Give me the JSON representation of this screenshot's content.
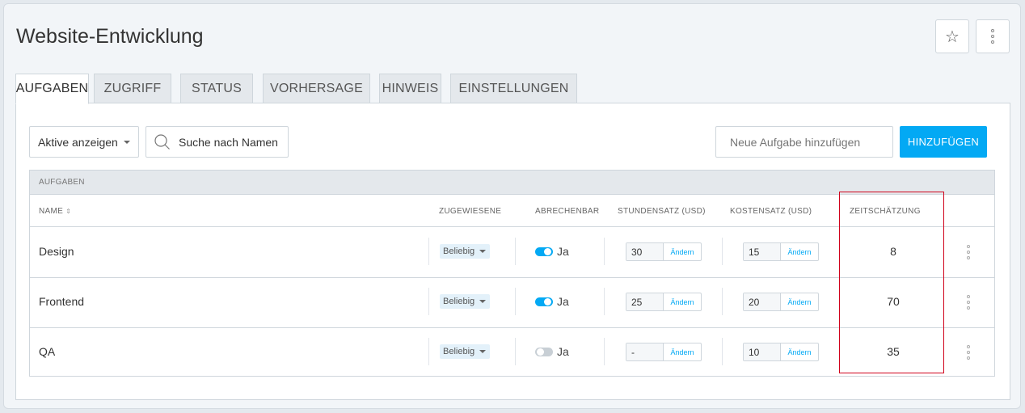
{
  "header": {
    "title": "Website-Entwicklung",
    "star_icon": "☆",
    "more_icon": "more-vertical-icon"
  },
  "tabs": [
    {
      "label": "AUFGABEN",
      "active": true
    },
    {
      "label": "ZUGRIFF",
      "active": false
    },
    {
      "label": "STATUS",
      "active": false
    },
    {
      "label": "VORHERSAGE",
      "active": false
    },
    {
      "label": "HINWEIS",
      "active": false
    },
    {
      "label": "EINSTELLUNGEN",
      "active": false
    }
  ],
  "toolbar": {
    "filter_label": "Aktive anzeigen",
    "search_label": "Suche nach Namen",
    "new_task_placeholder": "Neue Aufgabe hinzufügen",
    "add_button": "HINZUFÜGEN"
  },
  "table": {
    "group_header": "AUFGABEN",
    "columns": {
      "name": "NAME",
      "assigned": "ZUGEWIESENE",
      "billable": "ABRECHENBAR",
      "hourly_rate": "STUNDENSATZ (USD)",
      "cost_rate": "KOSTENSATZ (USD)",
      "estimate": "ZEITSCHÄTZUNG"
    },
    "sort_icon": "⇕",
    "rows": [
      {
        "name": "Design",
        "assigned": "Beliebig",
        "billable": "Ja",
        "billable_on": true,
        "hourly_rate": "30",
        "hourly_action": "Ändern",
        "cost_rate": "15",
        "cost_action": "Ändern",
        "estimate": "8"
      },
      {
        "name": "Frontend",
        "assigned": "Beliebig",
        "billable": "Ja",
        "billable_on": true,
        "hourly_rate": "25",
        "hourly_action": "Ändern",
        "cost_rate": "20",
        "cost_action": "Ändern",
        "estimate": "70"
      },
      {
        "name": "QA",
        "assigned": "Beliebig",
        "billable": "Ja",
        "billable_on": false,
        "hourly_rate": "-",
        "hourly_action": "Ändern",
        "cost_rate": "10",
        "cost_action": "Ändern",
        "estimate": "35"
      }
    ]
  },
  "colors": {
    "accent": "#03a9f4",
    "highlight": "#d0021b"
  }
}
